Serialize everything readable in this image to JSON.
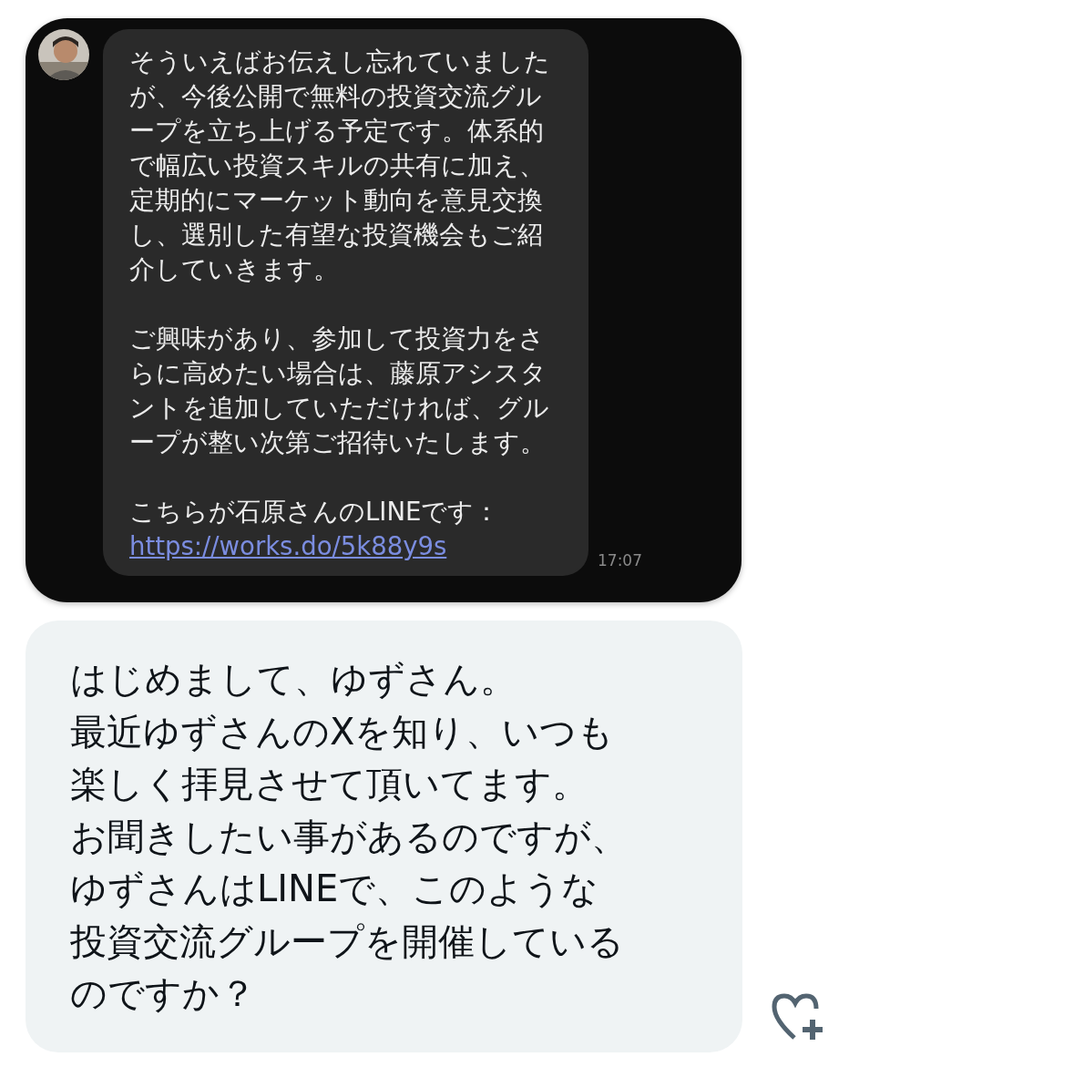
{
  "shared_screenshot": {
    "message": {
      "paragraphs": [
        [
          "そういえばお伝えし忘れていました",
          "が、今後公開で無料の投資交流グル",
          "ープを立ち上げる予定です。体系的",
          "で幅広い投資スキルの共有に加え、",
          "定期的にマーケット動向を意見交換",
          "し、選別した有望な投資機会もご紹",
          "介していきます。"
        ],
        [
          "ご興味があり、参加して投資力をさ",
          "らに高めたい場合は、藤原アシスタ",
          "ントを追加していただければ、グル",
          "ープが整い次第ご招待いたします。"
        ],
        [
          "こちらが石原さんのLINEです："
        ]
      ],
      "link": "https://works.do/5k88y9s",
      "time": "17:07"
    }
  },
  "reply": {
    "lines": [
      "はじめまして、ゆずさん。",
      "最近ゆずさんのXを知り、いつも",
      "楽しく拝見させて頂いてます。",
      "お聞きしたい事があるのですが、",
      "ゆずさんはLINEで、このような",
      "投資交流グループを開催している",
      "のですか？"
    ],
    "liked": false
  }
}
